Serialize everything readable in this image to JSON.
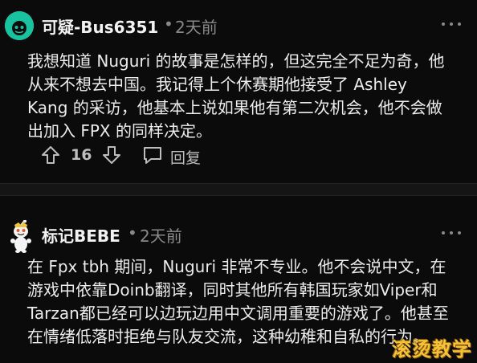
{
  "comments": [
    {
      "username": "可疑-Bus6351",
      "separator": "•",
      "time": "2天前",
      "text": "我想知道 Nuguri 的故事是怎样的，但这完全不足为奇，他从来不想去中国。我记得上个休赛期他接受了 Ashley Kang 的采访，他基本上说如果他有第二次机会，他不会做出加入 FPX 的同样决定。",
      "votes": "16",
      "reply_label": "回复",
      "avatar_icon": "teal-round-avatar-icon"
    },
    {
      "username": "标记BEBE",
      "separator": "•",
      "time": "2天前",
      "text": "在 Fpx tbh 期间，Nuguri 非常不专业。他不会说中文，在游戏中依靠Doinb翻译，同时其他所有韩国玩家如Viper和Tarzan都已经可以边玩边用中文调用重要的游戏了。他甚至在情绪低落时拒绝与队友交流，这种幼稚和自私的行为。",
      "avatar_icon": "snoo-avatar-icon"
    }
  ],
  "watermark": "滚烫教学",
  "colors": {
    "background": "#0b0b0b",
    "text": "#ececec",
    "meta": "#8a8a8a",
    "accent": "#19c3a0",
    "watermark": "#f3c23a"
  }
}
